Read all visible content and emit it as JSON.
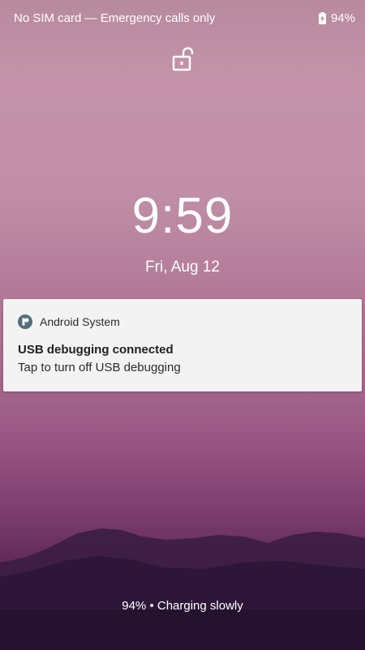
{
  "status_bar": {
    "carrier_text": "No SIM card — Emergency calls only",
    "battery_percent": "94%",
    "icons": [
      "battery-charging-icon"
    ]
  },
  "lockscreen": {
    "lock_icon": "unlocked-padlock-icon",
    "time": "9:59",
    "date": "Fri, Aug 12",
    "charging_status": "94% • Charging slowly"
  },
  "notification": {
    "app_name": "Android System",
    "app_icon": "android-system-icon",
    "title": "USB debugging connected",
    "text": "Tap to turn off USB debugging"
  },
  "colors": {
    "app_icon": "#546e7a",
    "card_background": "#f3f3f3",
    "text_on_wallpaper": "#ffffff"
  }
}
